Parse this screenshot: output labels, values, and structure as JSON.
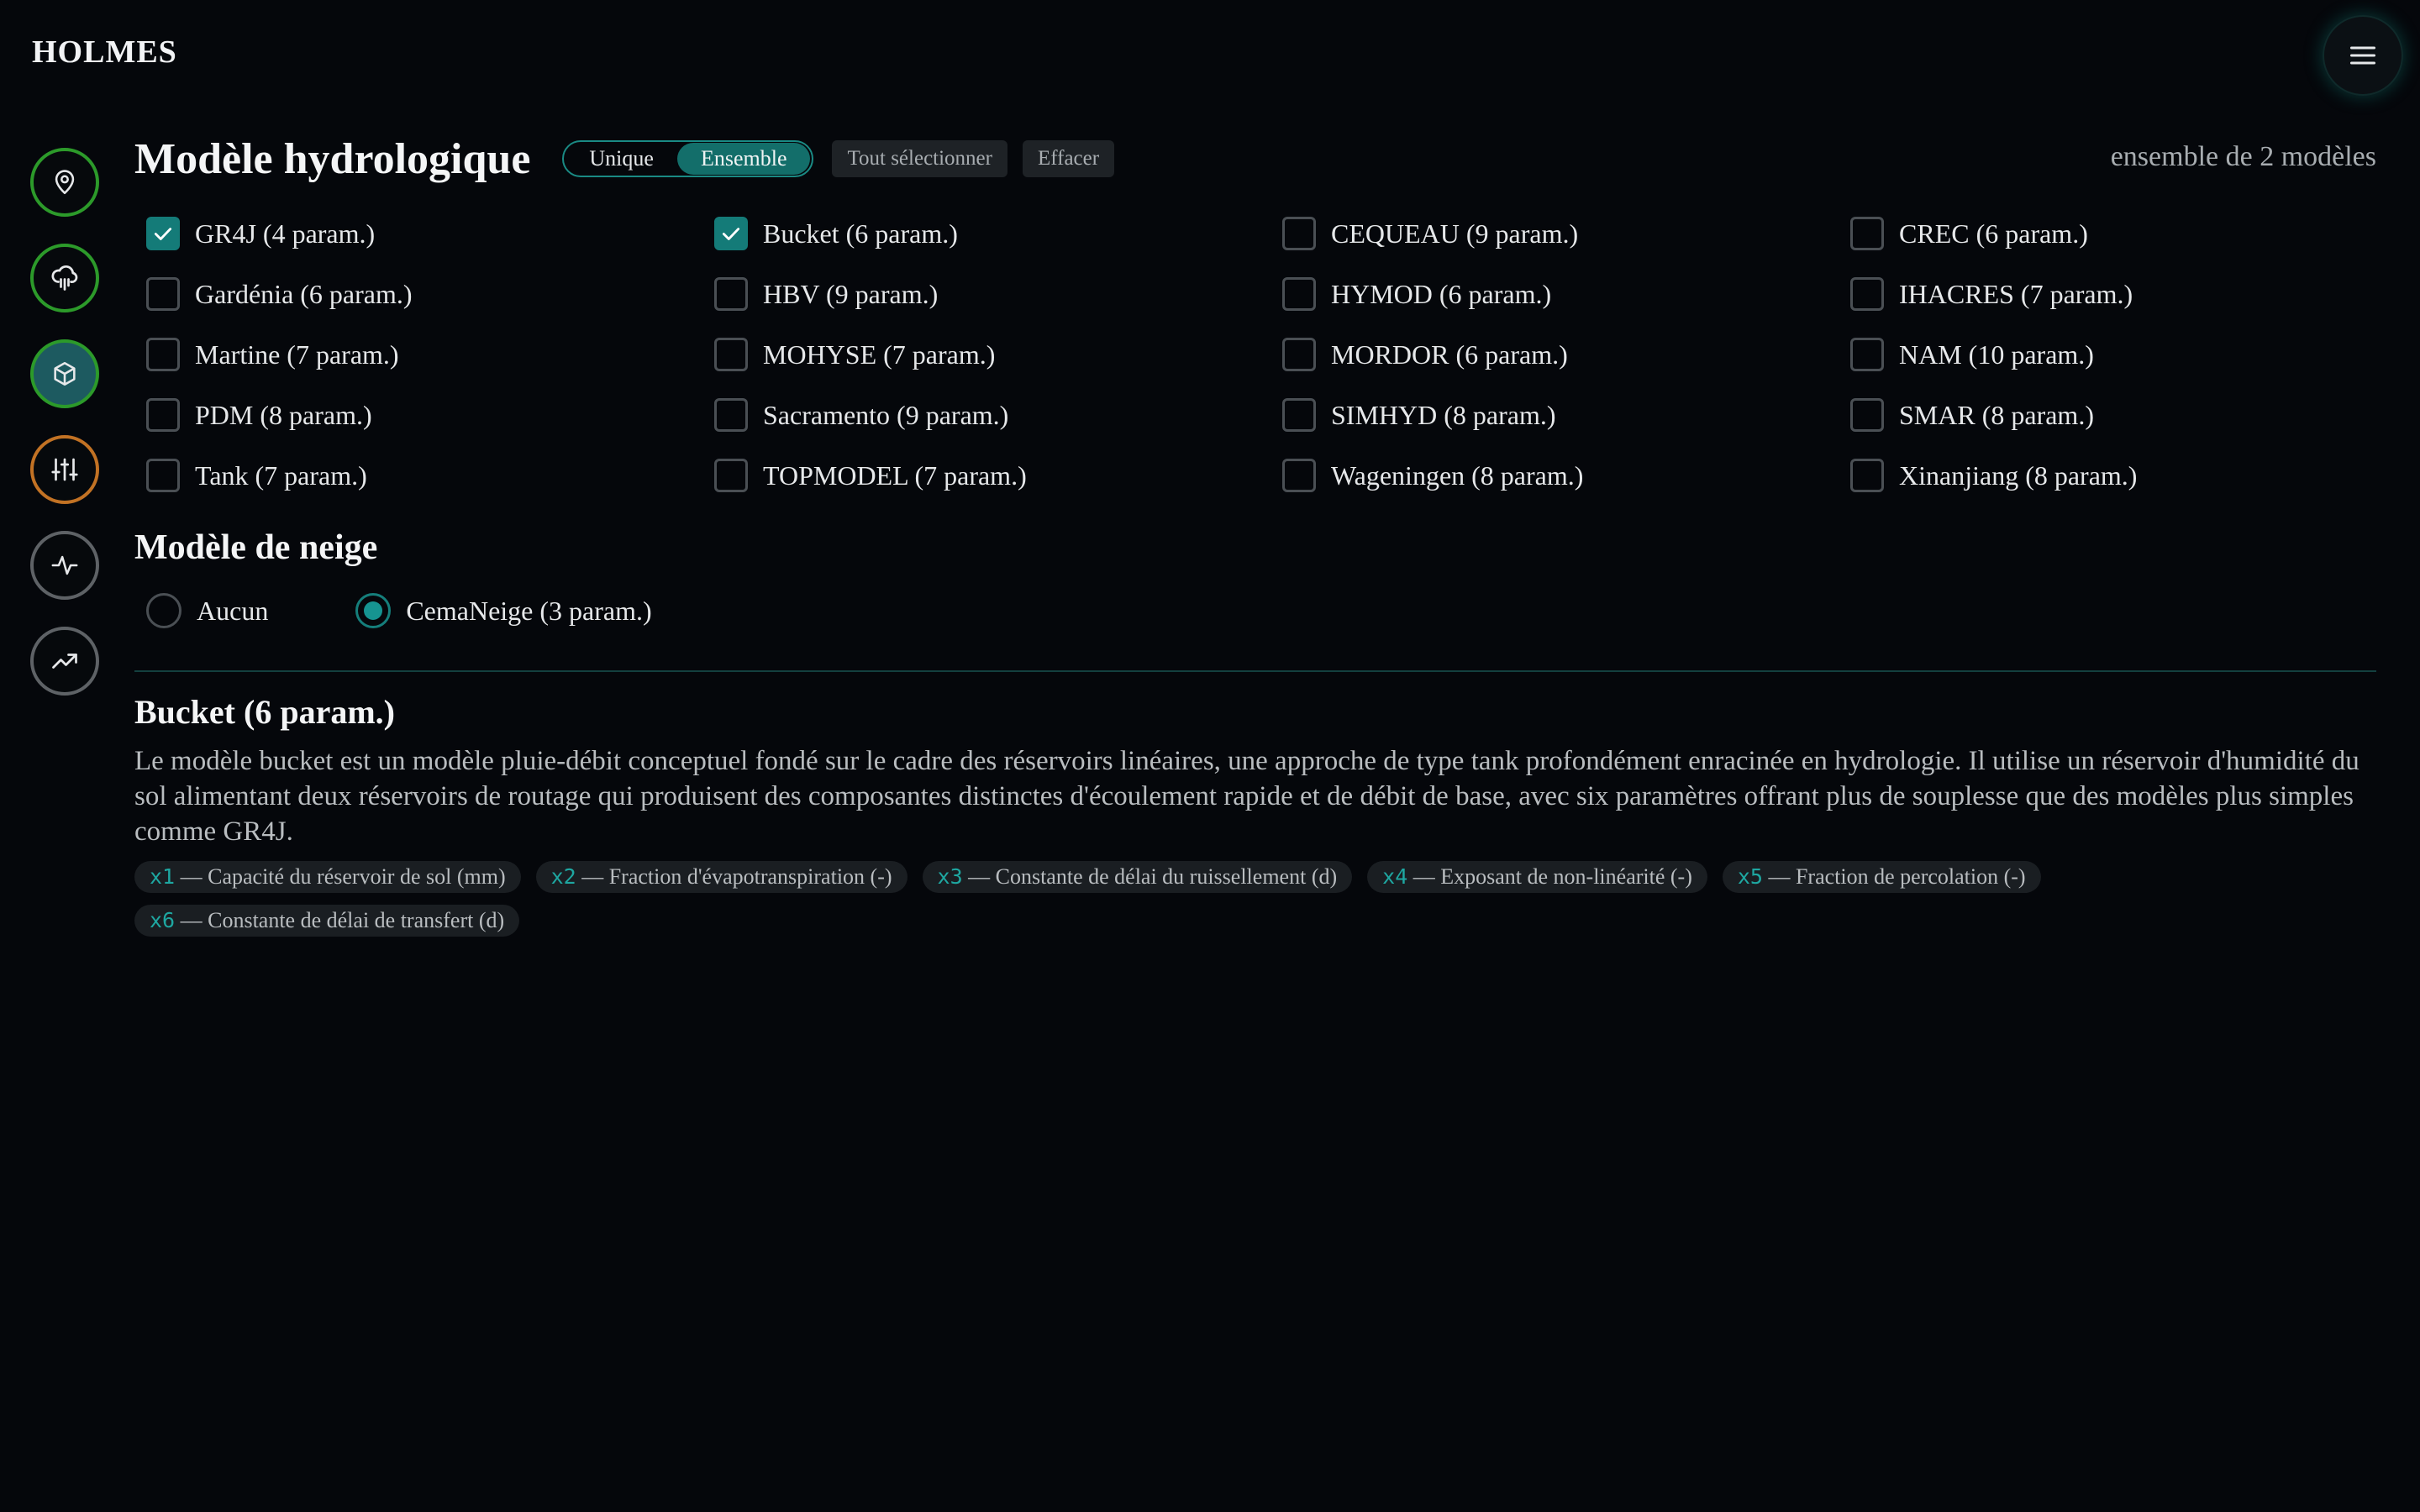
{
  "app": {
    "brand": "HOLMES"
  },
  "rail": [
    {
      "icon": "map-pin-icon",
      "variant": "green"
    },
    {
      "icon": "rain-cloud-icon",
      "variant": "green"
    },
    {
      "icon": "cube-icon",
      "variant": "active"
    },
    {
      "icon": "sliders-icon",
      "variant": "orange"
    },
    {
      "icon": "activity-icon",
      "variant": "gray"
    },
    {
      "icon": "trending-up-icon",
      "variant": "gray"
    }
  ],
  "header": {
    "title": "Modèle hydrologique",
    "mode_unique": "Unique",
    "mode_ensemble": "Ensemble",
    "mode_selected": "Ensemble",
    "select_all": "Tout sélectionner",
    "clear": "Effacer",
    "ensemble_note": "ensemble de 2 modèles"
  },
  "models": [
    {
      "label": "GR4J (4 param.)",
      "checked": true
    },
    {
      "label": "Bucket (6 param.)",
      "checked": true
    },
    {
      "label": "CEQUEAU (9 param.)",
      "checked": false
    },
    {
      "label": "CREC (6 param.)",
      "checked": false
    },
    {
      "label": "Gardénia (6 param.)",
      "checked": false
    },
    {
      "label": "HBV (9 param.)",
      "checked": false
    },
    {
      "label": "HYMOD (6 param.)",
      "checked": false
    },
    {
      "label": "IHACRES (7 param.)",
      "checked": false
    },
    {
      "label": "Martine (7 param.)",
      "checked": false
    },
    {
      "label": "MOHYSE (7 param.)",
      "checked": false
    },
    {
      "label": "MORDOR (6 param.)",
      "checked": false
    },
    {
      "label": "NAM (10 param.)",
      "checked": false
    },
    {
      "label": "PDM (8 param.)",
      "checked": false
    },
    {
      "label": "Sacramento (9 param.)",
      "checked": false
    },
    {
      "label": "SIMHYD (8 param.)",
      "checked": false
    },
    {
      "label": "SMAR (8 param.)",
      "checked": false
    },
    {
      "label": "Tank (7 param.)",
      "checked": false
    },
    {
      "label": "TOPMODEL (7 param.)",
      "checked": false
    },
    {
      "label": "Wageningen (8 param.)",
      "checked": false
    },
    {
      "label": "Xinanjiang (8 param.)",
      "checked": false
    }
  ],
  "snow": {
    "title": "Modèle de neige",
    "options": [
      {
        "label": "Aucun",
        "selected": false
      },
      {
        "label": "CemaNeige (3 param.)",
        "selected": true
      }
    ]
  },
  "detail": {
    "title": "Bucket (6 param.)",
    "description": "Le modèle bucket est un modèle pluie-débit conceptuel fondé sur le cadre des réservoirs linéaires, une approche de type tank profondément enracinée en hydrologie. Il utilise un réservoir d'humidité du sol alimentant deux réservoirs de routage qui produisent des composantes distinctes d'écoulement rapide et de débit de base, avec six paramètres offrant plus de souplesse que des modèles plus simples comme GR4J.",
    "params": [
      {
        "key": "x1",
        "desc": " — Capacité du réservoir de sol (mm)"
      },
      {
        "key": "x2",
        "desc": " — Fraction d'évapotranspiration (-)"
      },
      {
        "key": "x3",
        "desc": " — Constante de délai du ruissellement (d)"
      },
      {
        "key": "x4",
        "desc": " — Exposant de non-linéarité (-)"
      },
      {
        "key": "x5",
        "desc": " — Fraction de percolation (-)"
      },
      {
        "key": "x6",
        "desc": " — Constante de délai de transfert (d)"
      }
    ]
  },
  "colors": {
    "accent": "#147b78",
    "background": "#05070b",
    "rail_green": "#2c9a2a",
    "rail_orange": "#c27224"
  }
}
